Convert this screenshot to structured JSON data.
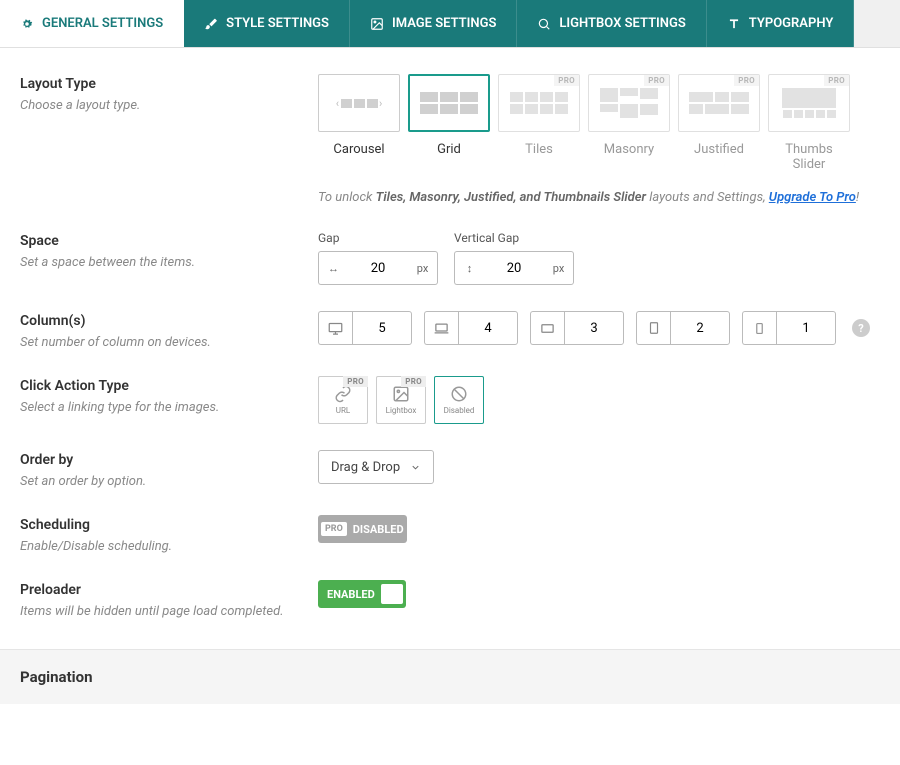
{
  "tabs": [
    {
      "label": "GENERAL SETTINGS",
      "active": true
    },
    {
      "label": "STYLE SETTINGS",
      "active": false
    },
    {
      "label": "IMAGE SETTINGS",
      "active": false
    },
    {
      "label": "LIGHTBOX SETTINGS",
      "active": false
    },
    {
      "label": "TYPOGRAPHY",
      "active": false
    }
  ],
  "layout": {
    "title": "Layout Type",
    "desc": "Choose a layout type.",
    "options": [
      {
        "name": "Carousel",
        "pro": false
      },
      {
        "name": "Grid",
        "pro": false,
        "selected": true
      },
      {
        "name": "Tiles",
        "pro": true
      },
      {
        "name": "Masonry",
        "pro": true
      },
      {
        "name": "Justified",
        "pro": true
      },
      {
        "name": "Thumbs Slider",
        "pro": true
      }
    ],
    "pro_tag": "PRO",
    "upsell_prefix": "To unlock ",
    "upsell_bold": "Tiles, Masonry, Justified, and Thumbnails Slider",
    "upsell_mid": " layouts and Settings, ",
    "upsell_link": "Upgrade To Pro",
    "upsell_suffix": "!"
  },
  "space": {
    "title": "Space",
    "desc": "Set a space between the items.",
    "gap": {
      "label": "Gap",
      "value": "20",
      "unit": "px"
    },
    "vgap": {
      "label": "Vertical Gap",
      "value": "20",
      "unit": "px"
    }
  },
  "columns": {
    "title": "Column(s)",
    "desc": "Set number of column on devices.",
    "values": [
      "5",
      "4",
      "3",
      "2",
      "1"
    ]
  },
  "click": {
    "title": "Click Action Type",
    "desc": "Select a linking type for the images.",
    "options": [
      {
        "label": "URL",
        "pro": true
      },
      {
        "label": "Lightbox",
        "pro": true
      },
      {
        "label": "Disabled",
        "pro": false,
        "selected": true
      }
    ]
  },
  "orderby": {
    "title": "Order by",
    "desc": "Set an order by option.",
    "value": "Drag & Drop"
  },
  "scheduling": {
    "title": "Scheduling",
    "desc": "Enable/Disable scheduling.",
    "pro_tag": "PRO",
    "state": "DISABLED"
  },
  "preloader": {
    "title": "Preloader",
    "desc": "Items will be hidden until page load completed.",
    "state": "ENABLED"
  },
  "pagination": {
    "title": "Pagination"
  }
}
